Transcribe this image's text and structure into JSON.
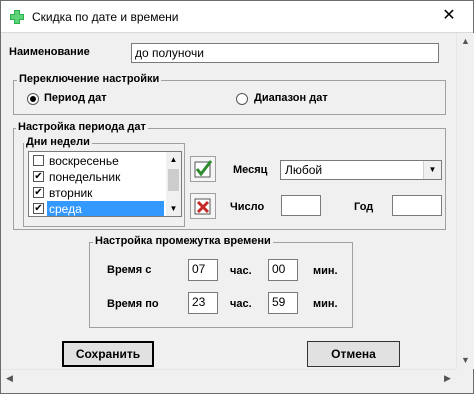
{
  "window": {
    "title": "Скидка по дате и времени",
    "close_glyph": "✕",
    "icon": "green-plus-icon"
  },
  "name_field": {
    "label": "Наименование",
    "value": "до полуночи"
  },
  "switch_group": {
    "title": "Переключение настройки",
    "option_period": "Период дат",
    "option_range": "Диапазон дат",
    "selected": "period"
  },
  "period_group": {
    "title": "Настройка периода дат",
    "weekdays_title": "Дни недели",
    "weekdays": [
      {
        "label": "воскресенье",
        "checked": false,
        "selected": false
      },
      {
        "label": "понедельник",
        "checked": true,
        "selected": false
      },
      {
        "label": "вторник",
        "checked": true,
        "selected": false
      },
      {
        "label": "среда",
        "checked": true,
        "selected": true
      }
    ],
    "month_label": "Месяц",
    "month_value": "Любой",
    "day_label": "Число",
    "day_value": "",
    "year_label": "Год",
    "year_value": ""
  },
  "time_group": {
    "title": "Настройка промежутка времени",
    "from_label": "Время с",
    "to_label": "Время по",
    "hours_unit": "час.",
    "minutes_unit": "мин.",
    "from_hours": "07",
    "from_minutes": "00",
    "to_hours": "23",
    "to_minutes": "59"
  },
  "buttons": {
    "save": "Сохранить",
    "cancel": "Отмена"
  },
  "colors": {
    "selection": "#3399ff",
    "check_green": "#2e8b2e",
    "uncheck_red": "#c62828"
  }
}
